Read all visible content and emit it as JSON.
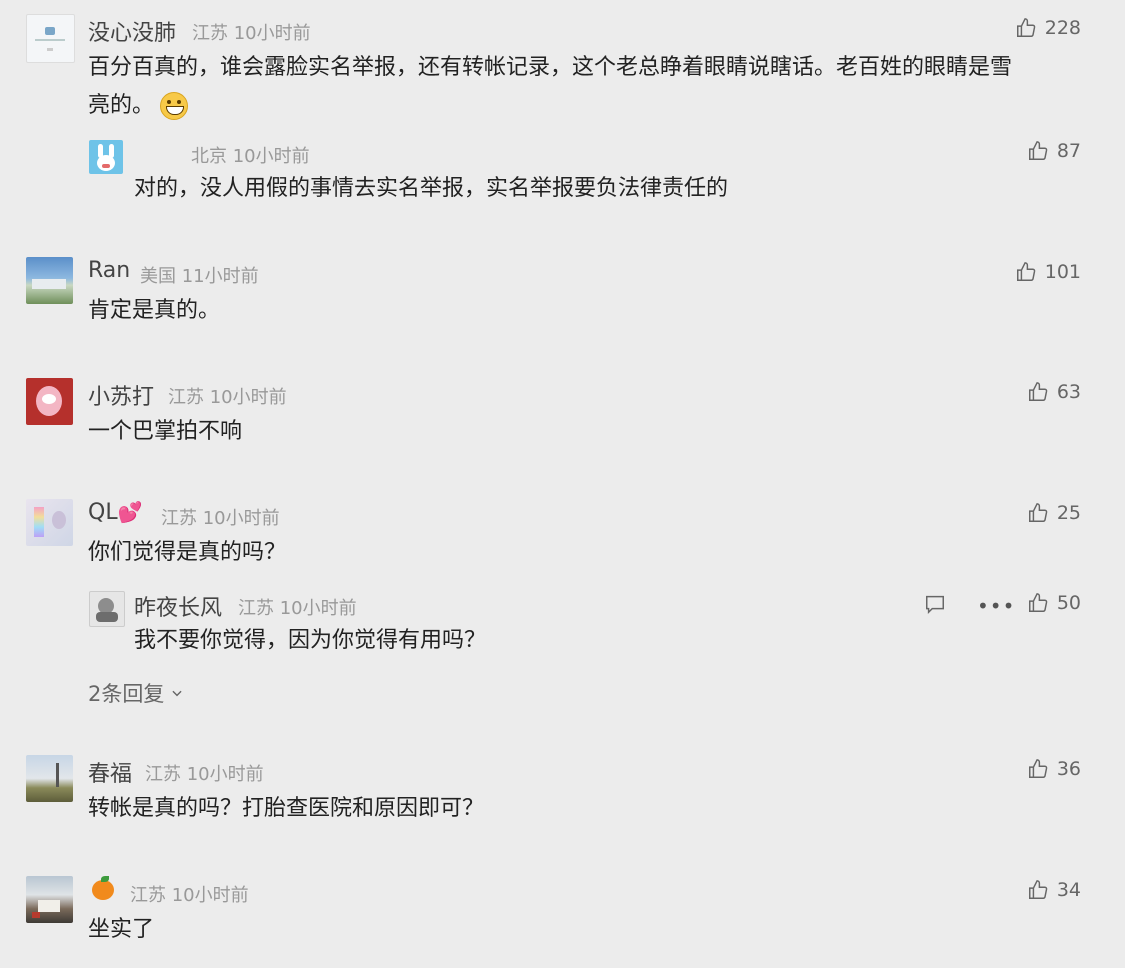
{
  "comments": [
    {
      "username": "没心没肺",
      "location": "江苏",
      "time": "10小时前",
      "likes": "228",
      "text_line1": "百分百真的，谁会露脸实名举报，还有转帐记录，这个老总睁着眼睛说瞎话。老百姓的眼睛是雪",
      "text_line2": "亮的。",
      "emoji": "grin-emoji",
      "reply": {
        "username": "",
        "location": "北京",
        "time": "10小时前",
        "likes": "87",
        "text": "对的，没人用假的事情去实名举报，实名举报要负法律责任的"
      }
    },
    {
      "username": "Ran",
      "location": "美国",
      "time": "11小时前",
      "likes": "101",
      "text": "肯定是真的。"
    },
    {
      "username": "小苏打",
      "location": "江苏",
      "time": "10小时前",
      "likes": "63",
      "text": "一个巴掌拍不响"
    },
    {
      "username": "QL",
      "username_emoji": "💕",
      "location": "江苏",
      "time": "10小时前",
      "likes": "25",
      "text": "你们觉得是真的吗？",
      "reply": {
        "username": "昨夜长风",
        "location": "江苏",
        "time": "10小时前",
        "likes": "50",
        "text": "我不要你觉得，因为你觉得有用吗？"
      },
      "more_replies": "2条回复"
    },
    {
      "username": "春福",
      "location": "江苏",
      "time": "10小时前",
      "likes": "36",
      "text": "转帐是真的吗？打胎查医院和原因即可？"
    },
    {
      "username": "🍊",
      "location": "江苏",
      "time": "10小时前",
      "likes": "34",
      "text": "坐实了"
    }
  ],
  "colors": {
    "background": "#ececec",
    "text": "#222222",
    "meta": "#999999"
  }
}
